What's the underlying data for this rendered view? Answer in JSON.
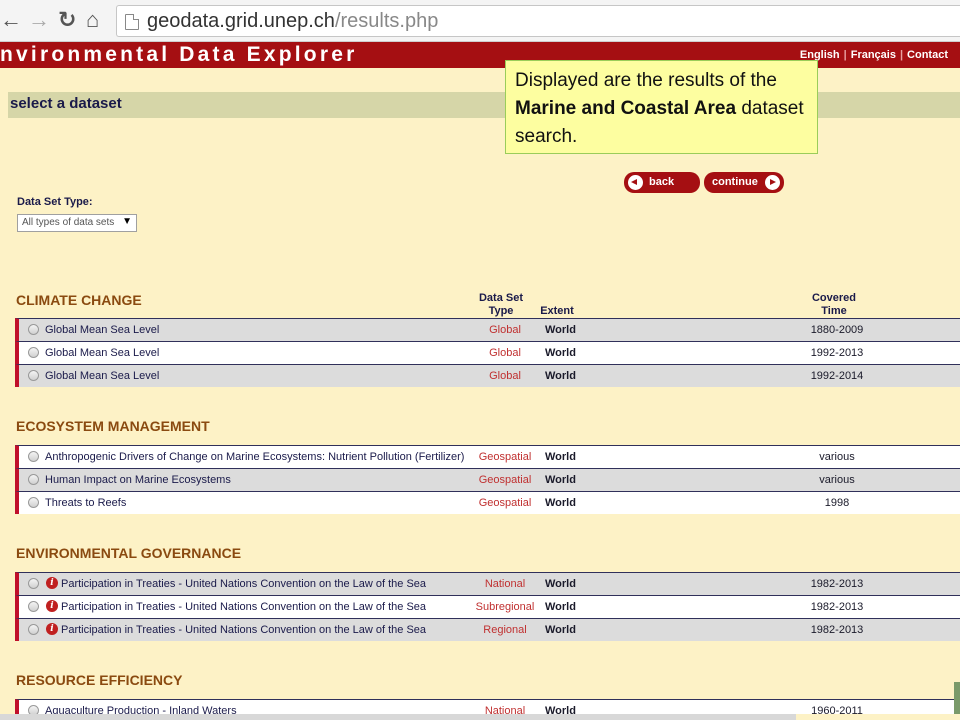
{
  "browser": {
    "url_host": "geodata.grid.unep.ch",
    "url_path": "/results.php"
  },
  "banner": {
    "title": "nvironmental Data Explorer",
    "links": [
      "English",
      "Français",
      "Contact"
    ]
  },
  "section_title": "select a dataset",
  "callout": {
    "pre": "Displayed are the results of the ",
    "bold": "Marine and Coastal Area",
    "post": " dataset search."
  },
  "buttons": {
    "back": "back",
    "continue": "continue"
  },
  "filter": {
    "label": "Data Set Type:",
    "selected": "All types of data sets"
  },
  "columns": {
    "type_line1": "Data Set",
    "type_line2": "Type",
    "extent": "Extent",
    "time_line1": "Covered",
    "time_line2": "Time"
  },
  "categories": [
    {
      "title": "CLIMATE CHANGE",
      "rows": [
        {
          "title": "Global Mean Sea Level",
          "type": "Global",
          "extent": "World",
          "time": "1880-2009"
        },
        {
          "title": "Global Mean Sea Level",
          "type": "Global",
          "extent": "World",
          "time": "1992-2013"
        },
        {
          "title": "Global Mean Sea Level",
          "type": "Global",
          "extent": "World",
          "time": "1992-2014"
        }
      ]
    },
    {
      "title": "ECOSYSTEM MANAGEMENT",
      "rows": [
        {
          "title": "Anthropogenic Drivers of Change on Marine Ecosystems: Nutrient Pollution (Fertilizer)",
          "type": "Geospatial",
          "extent": "World",
          "time": "various"
        },
        {
          "title": "Human Impact on Marine Ecosystems",
          "type": "Geospatial",
          "extent": "World",
          "time": "various"
        },
        {
          "title": "Threats to Reefs",
          "type": "Geospatial",
          "extent": "World",
          "time": "1998"
        }
      ]
    },
    {
      "title": "ENVIRONMENTAL GOVERNANCE",
      "rows": [
        {
          "title": "Participation in Treaties - United Nations Convention on the Law of the Sea",
          "type": "National",
          "extent": "World",
          "time": "1982-2013"
        },
        {
          "title": "Participation in Treaties - United Nations Convention on the Law of the Sea",
          "type": "Subregional",
          "extent": "World",
          "time": "1982-2013"
        },
        {
          "title": "Participation in Treaties - United Nations Convention on the Law of the Sea",
          "type": "Regional",
          "extent": "World",
          "time": "1982-2013"
        }
      ]
    },
    {
      "title": "RESOURCE EFFICIENCY",
      "rows": [
        {
          "title": "Aquaculture Production - Inland Waters",
          "type": "National",
          "extent": "World",
          "time": "1960-2011"
        }
      ]
    }
  ],
  "info_icon_glyph": "i"
}
